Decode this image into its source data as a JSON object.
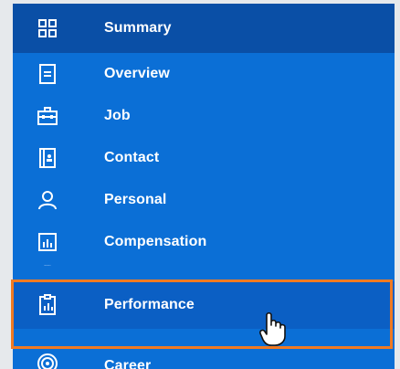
{
  "nav": {
    "items": [
      {
        "label": "Summary",
        "icon": "grid-icon"
      },
      {
        "label": "Overview",
        "icon": "document-icon"
      },
      {
        "label": "Job",
        "icon": "briefcase-icon"
      },
      {
        "label": "Contact",
        "icon": "contact-book-icon"
      },
      {
        "label": "Personal",
        "icon": "person-icon"
      },
      {
        "label": "Compensation",
        "icon": "bar-chart-icon"
      },
      {
        "label": "Performance",
        "icon": "clipboard-chart-icon"
      },
      {
        "label": "Career",
        "icon": "target-icon"
      }
    ]
  },
  "colors": {
    "nav_bg": "#0b6fd6",
    "selected_bg": "#0a4fa6",
    "hover_bg": "#0b5fc4",
    "highlight": "#f07a22"
  }
}
